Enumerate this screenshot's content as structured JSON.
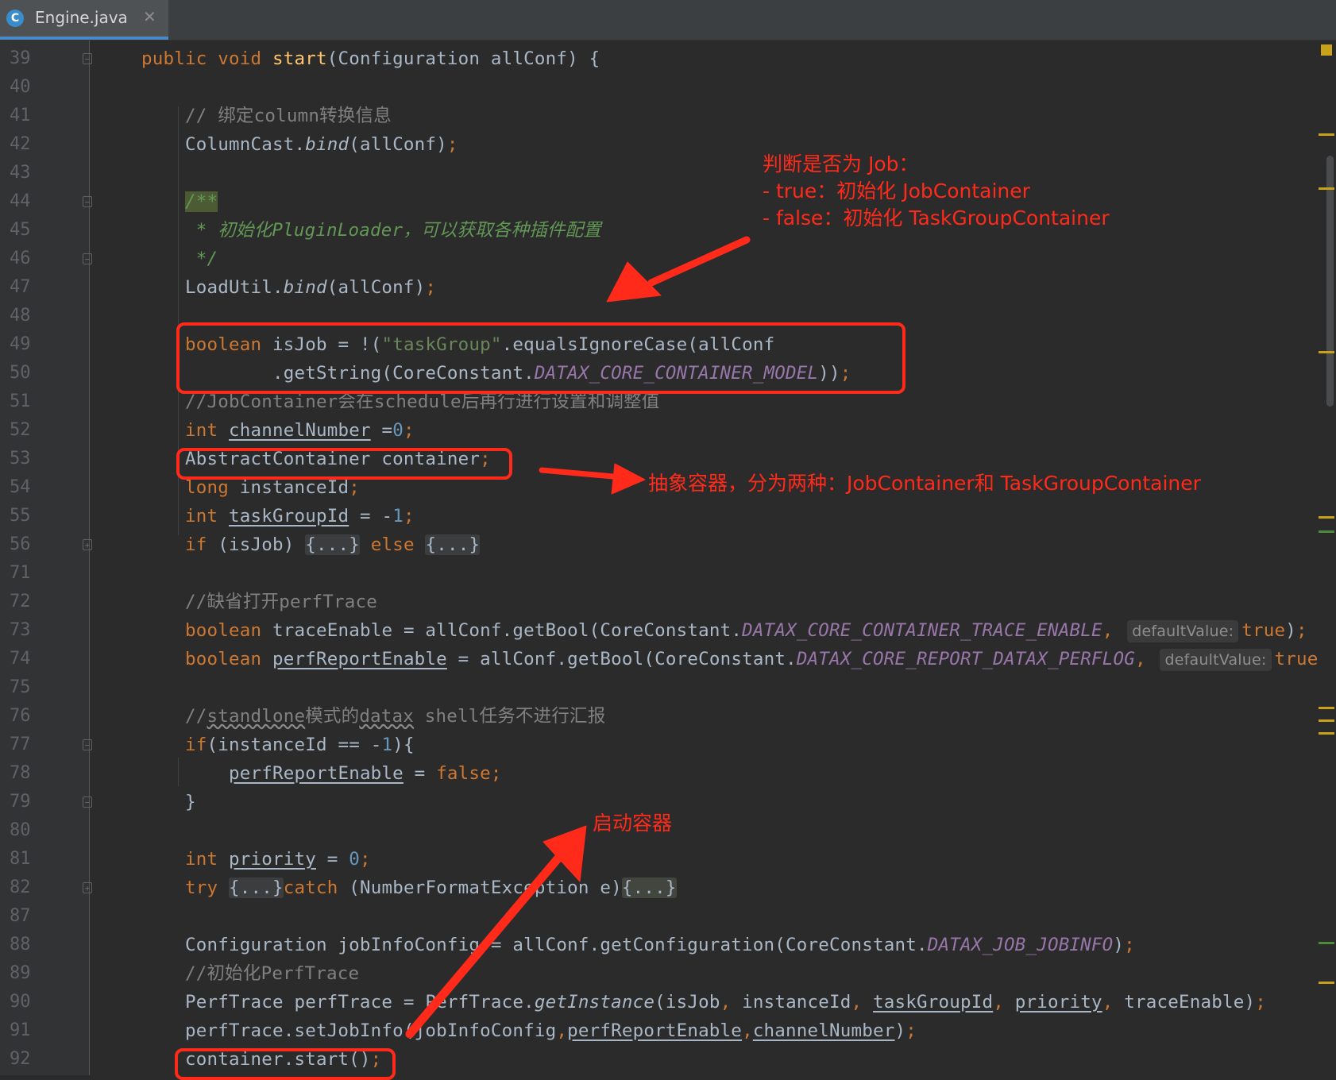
{
  "tab": {
    "title": "Engine.java",
    "icon": "C",
    "close": "✕"
  },
  "lines": [
    {
      "num": "39",
      "fold": "−"
    },
    {
      "num": "40"
    },
    {
      "num": "41"
    },
    {
      "num": "42"
    },
    {
      "num": "43"
    },
    {
      "num": "44",
      "fold": "−"
    },
    {
      "num": "45"
    },
    {
      "num": "46",
      "fold": "−"
    },
    {
      "num": "47"
    },
    {
      "num": "48"
    },
    {
      "num": "49"
    },
    {
      "num": "50"
    },
    {
      "num": "51"
    },
    {
      "num": "52"
    },
    {
      "num": "53"
    },
    {
      "num": "54"
    },
    {
      "num": "55"
    },
    {
      "num": "56",
      "fold": "+"
    },
    {
      "num": "71"
    },
    {
      "num": "72"
    },
    {
      "num": "73"
    },
    {
      "num": "74"
    },
    {
      "num": "75"
    },
    {
      "num": "76"
    },
    {
      "num": "77",
      "fold": "−"
    },
    {
      "num": "78"
    },
    {
      "num": "79",
      "fold": "−"
    },
    {
      "num": "80"
    },
    {
      "num": "81"
    },
    {
      "num": "82",
      "fold": "+"
    },
    {
      "num": "87"
    },
    {
      "num": "88"
    },
    {
      "num": "89"
    },
    {
      "num": "90"
    },
    {
      "num": "91"
    },
    {
      "num": "92"
    }
  ],
  "code": [
    [
      {
        "t": "public void ",
        "c": "kw"
      },
      {
        "t": "start",
        "c": "fn"
      },
      {
        "t": "(Configuration allConf) {"
      }
    ],
    [],
    [
      {
        "t": "    // 绑定column转换信息",
        "c": "cm"
      }
    ],
    [
      {
        "t": "    ColumnCast."
      },
      {
        "t": "bind",
        "c": "it"
      },
      {
        "t": "(allConf)"
      },
      {
        "t": ";",
        "c": "kw"
      }
    ],
    [],
    [
      {
        "t": "    "
      },
      {
        "t": "/**",
        "c": "doc docbg"
      }
    ],
    [
      {
        "t": "     * 初始化",
        "c": "doc"
      },
      {
        "t": "PluginLoader",
        "c": "doc"
      },
      {
        "t": "，可以获取各种插件配置",
        "c": "doc"
      }
    ],
    [
      {
        "t": "     */",
        "c": "doc"
      }
    ],
    [
      {
        "t": "    LoadUtil."
      },
      {
        "t": "bind",
        "c": "it"
      },
      {
        "t": "(allConf)"
      },
      {
        "t": ";",
        "c": "kw"
      }
    ],
    [],
    [
      {
        "t": "    "
      },
      {
        "t": "boolean ",
        "c": "kw"
      },
      {
        "t": "isJob = !("
      },
      {
        "t": "\"taskGroup\"",
        "c": "str"
      },
      {
        "t": ".equalsIgnoreCase(allConf"
      }
    ],
    [
      {
        "t": "            .getString(CoreConstant."
      },
      {
        "t": "DATAX_CORE_CONTAINER_MODEL",
        "c": "const"
      },
      {
        "t": "))"
      },
      {
        "t": ";",
        "c": "kw"
      }
    ],
    [
      {
        "t": "    //JobContainer会在schedule后再行进行设置和调整值",
        "c": "cm"
      }
    ],
    [
      {
        "t": "    "
      },
      {
        "t": "int ",
        "c": "kw"
      },
      {
        "t": "channelNumber",
        "c": "ul"
      },
      {
        "t": " ="
      },
      {
        "t": "0",
        "c": "num"
      },
      {
        "t": ";",
        "c": "kw"
      }
    ],
    [
      {
        "t": "    AbstractContainer container"
      },
      {
        "t": ";",
        "c": "kw"
      }
    ],
    [
      {
        "t": "    "
      },
      {
        "t": "long ",
        "c": "kw"
      },
      {
        "t": "instanceId"
      },
      {
        "t": ";",
        "c": "kw"
      }
    ],
    [
      {
        "t": "    "
      },
      {
        "t": "int ",
        "c": "kw"
      },
      {
        "t": "taskGroupId",
        "c": "ul"
      },
      {
        "t": " = -"
      },
      {
        "t": "1",
        "c": "num"
      },
      {
        "t": ";",
        "c": "kw"
      }
    ],
    [
      {
        "t": "    "
      },
      {
        "t": "if ",
        "c": "kw"
      },
      {
        "t": "(isJob) "
      },
      {
        "t": "{...}",
        "c": "folded"
      },
      {
        "t": " "
      },
      {
        "t": "else ",
        "c": "kw"
      },
      {
        "t": "{...}",
        "c": "folded"
      }
    ],
    [],
    [
      {
        "t": "    //缺省打开perfTrace",
        "c": "cm"
      }
    ],
    [
      {
        "t": "    "
      },
      {
        "t": "boolean ",
        "c": "kw"
      },
      {
        "t": "traceEnable = allConf.getBool(CoreConstant."
      },
      {
        "t": "DATAX_CORE_CONTAINER_TRACE_ENABLE",
        "c": "const"
      },
      {
        "t": ", ",
        "c": "kw"
      },
      {
        "t": "defaultValue:",
        "c": "hint"
      },
      {
        "t": "true",
        "c": "kw"
      },
      {
        "t": ")"
      },
      {
        "t": ";",
        "c": "kw"
      }
    ],
    [
      {
        "t": "    "
      },
      {
        "t": "boolean ",
        "c": "kw"
      },
      {
        "t": "perfReportEnable",
        "c": "ul"
      },
      {
        "t": " = allConf.getBool(CoreConstant."
      },
      {
        "t": "DATAX_CORE_REPORT_DATAX_PERFLOG",
        "c": "const"
      },
      {
        "t": ", ",
        "c": "kw"
      },
      {
        "t": "defaultValue:",
        "c": "hint"
      },
      {
        "t": "true",
        "c": "kw"
      }
    ],
    [],
    [
      {
        "t": "    //",
        "c": "cm"
      },
      {
        "t": "standlone",
        "c": "cm wavy"
      },
      {
        "t": "模式的",
        "c": "cm"
      },
      {
        "t": "datax",
        "c": "cm wavy"
      },
      {
        "t": " shell任务不进行汇报",
        "c": "cm"
      }
    ],
    [
      {
        "t": "    "
      },
      {
        "t": "if",
        "c": "kw"
      },
      {
        "t": "(instanceId == -"
      },
      {
        "t": "1",
        "c": "num"
      },
      {
        "t": "){"
      }
    ],
    [
      {
        "t": "        "
      },
      {
        "t": "perfReportEnable",
        "c": "ul"
      },
      {
        "t": " = "
      },
      {
        "t": "false;",
        "c": "kw"
      }
    ],
    [
      {
        "t": "    }"
      }
    ],
    [],
    [
      {
        "t": "    "
      },
      {
        "t": "int ",
        "c": "kw"
      },
      {
        "t": "priority",
        "c": "ul"
      },
      {
        "t": " = "
      },
      {
        "t": "0",
        "c": "num"
      },
      {
        "t": ";",
        "c": "kw"
      }
    ],
    [
      {
        "t": "    "
      },
      {
        "t": "try ",
        "c": "kw"
      },
      {
        "t": "{...}",
        "c": "folded"
      },
      {
        "t": "catch ",
        "c": "kw"
      },
      {
        "t": "(NumberFormatException e)"
      },
      {
        "t": "{...}",
        "c": "foldedy"
      }
    ],
    [],
    [
      {
        "t": "    Configuration jobInfoConfig = allConf.getConfiguration(CoreConstant."
      },
      {
        "t": "DATAX_JOB_JOBINFO",
        "c": "const"
      },
      {
        "t": ")"
      },
      {
        "t": ";",
        "c": "kw"
      }
    ],
    [
      {
        "t": "    //初始化PerfTrace",
        "c": "cm"
      }
    ],
    [
      {
        "t": "    PerfTrace perfTrace = PerfTrace."
      },
      {
        "t": "getInstance",
        "c": "it"
      },
      {
        "t": "(isJob"
      },
      {
        "t": ", ",
        "c": "kw"
      },
      {
        "t": "instanceId"
      },
      {
        "t": ", ",
        "c": "kw"
      },
      {
        "t": "taskGroupId",
        "c": "ul"
      },
      {
        "t": ", ",
        "c": "kw"
      },
      {
        "t": "priority",
        "c": "ul"
      },
      {
        "t": ", ",
        "c": "kw"
      },
      {
        "t": "traceEnable)"
      },
      {
        "t": ";",
        "c": "kw"
      }
    ],
    [
      {
        "t": "    perfTrace.setJobInfo(jobInfoConfig"
      },
      {
        "t": ",",
        "c": "kw"
      },
      {
        "t": "perfReportEnable",
        "c": "ul"
      },
      {
        "t": ",",
        "c": "kw"
      },
      {
        "t": "channelNumber",
        "c": "ul"
      },
      {
        "t": ")"
      },
      {
        "t": ";",
        "c": "kw"
      }
    ],
    [
      {
        "t": "    container.start()"
      },
      {
        "t": ";",
        "c": "kw"
      }
    ]
  ],
  "annotations": {
    "job_title": "判断是否为 Job：",
    "job_true": "- true：初始化 JobContainer",
    "job_false": "- false：初始化 TaskGroupContainer",
    "container_note": "抽象容器，分为两种：JobContainer和 TaskGroupContainer",
    "start_note": "启动容器"
  },
  "colors": {
    "annotation": "#ff2a1a",
    "background": "#2b2b2b",
    "keyword": "#cc7832"
  }
}
